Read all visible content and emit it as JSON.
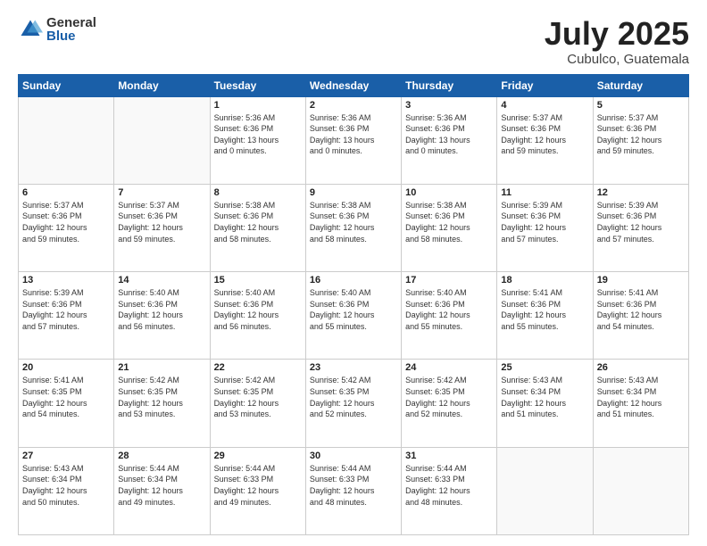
{
  "logo": {
    "general": "General",
    "blue": "Blue"
  },
  "title": "July 2025",
  "location": "Cubulco, Guatemala",
  "days_header": [
    "Sunday",
    "Monday",
    "Tuesday",
    "Wednesday",
    "Thursday",
    "Friday",
    "Saturday"
  ],
  "weeks": [
    [
      {
        "day": "",
        "info": ""
      },
      {
        "day": "",
        "info": ""
      },
      {
        "day": "1",
        "info": "Sunrise: 5:36 AM\nSunset: 6:36 PM\nDaylight: 13 hours\nand 0 minutes."
      },
      {
        "day": "2",
        "info": "Sunrise: 5:36 AM\nSunset: 6:36 PM\nDaylight: 13 hours\nand 0 minutes."
      },
      {
        "day": "3",
        "info": "Sunrise: 5:36 AM\nSunset: 6:36 PM\nDaylight: 13 hours\nand 0 minutes."
      },
      {
        "day": "4",
        "info": "Sunrise: 5:37 AM\nSunset: 6:36 PM\nDaylight: 12 hours\nand 59 minutes."
      },
      {
        "day": "5",
        "info": "Sunrise: 5:37 AM\nSunset: 6:36 PM\nDaylight: 12 hours\nand 59 minutes."
      }
    ],
    [
      {
        "day": "6",
        "info": "Sunrise: 5:37 AM\nSunset: 6:36 PM\nDaylight: 12 hours\nand 59 minutes."
      },
      {
        "day": "7",
        "info": "Sunrise: 5:37 AM\nSunset: 6:36 PM\nDaylight: 12 hours\nand 59 minutes."
      },
      {
        "day": "8",
        "info": "Sunrise: 5:38 AM\nSunset: 6:36 PM\nDaylight: 12 hours\nand 58 minutes."
      },
      {
        "day": "9",
        "info": "Sunrise: 5:38 AM\nSunset: 6:36 PM\nDaylight: 12 hours\nand 58 minutes."
      },
      {
        "day": "10",
        "info": "Sunrise: 5:38 AM\nSunset: 6:36 PM\nDaylight: 12 hours\nand 58 minutes."
      },
      {
        "day": "11",
        "info": "Sunrise: 5:39 AM\nSunset: 6:36 PM\nDaylight: 12 hours\nand 57 minutes."
      },
      {
        "day": "12",
        "info": "Sunrise: 5:39 AM\nSunset: 6:36 PM\nDaylight: 12 hours\nand 57 minutes."
      }
    ],
    [
      {
        "day": "13",
        "info": "Sunrise: 5:39 AM\nSunset: 6:36 PM\nDaylight: 12 hours\nand 57 minutes."
      },
      {
        "day": "14",
        "info": "Sunrise: 5:40 AM\nSunset: 6:36 PM\nDaylight: 12 hours\nand 56 minutes."
      },
      {
        "day": "15",
        "info": "Sunrise: 5:40 AM\nSunset: 6:36 PM\nDaylight: 12 hours\nand 56 minutes."
      },
      {
        "day": "16",
        "info": "Sunrise: 5:40 AM\nSunset: 6:36 PM\nDaylight: 12 hours\nand 55 minutes."
      },
      {
        "day": "17",
        "info": "Sunrise: 5:40 AM\nSunset: 6:36 PM\nDaylight: 12 hours\nand 55 minutes."
      },
      {
        "day": "18",
        "info": "Sunrise: 5:41 AM\nSunset: 6:36 PM\nDaylight: 12 hours\nand 55 minutes."
      },
      {
        "day": "19",
        "info": "Sunrise: 5:41 AM\nSunset: 6:36 PM\nDaylight: 12 hours\nand 54 minutes."
      }
    ],
    [
      {
        "day": "20",
        "info": "Sunrise: 5:41 AM\nSunset: 6:35 PM\nDaylight: 12 hours\nand 54 minutes."
      },
      {
        "day": "21",
        "info": "Sunrise: 5:42 AM\nSunset: 6:35 PM\nDaylight: 12 hours\nand 53 minutes."
      },
      {
        "day": "22",
        "info": "Sunrise: 5:42 AM\nSunset: 6:35 PM\nDaylight: 12 hours\nand 53 minutes."
      },
      {
        "day": "23",
        "info": "Sunrise: 5:42 AM\nSunset: 6:35 PM\nDaylight: 12 hours\nand 52 minutes."
      },
      {
        "day": "24",
        "info": "Sunrise: 5:42 AM\nSunset: 6:35 PM\nDaylight: 12 hours\nand 52 minutes."
      },
      {
        "day": "25",
        "info": "Sunrise: 5:43 AM\nSunset: 6:34 PM\nDaylight: 12 hours\nand 51 minutes."
      },
      {
        "day": "26",
        "info": "Sunrise: 5:43 AM\nSunset: 6:34 PM\nDaylight: 12 hours\nand 51 minutes."
      }
    ],
    [
      {
        "day": "27",
        "info": "Sunrise: 5:43 AM\nSunset: 6:34 PM\nDaylight: 12 hours\nand 50 minutes."
      },
      {
        "day": "28",
        "info": "Sunrise: 5:44 AM\nSunset: 6:34 PM\nDaylight: 12 hours\nand 49 minutes."
      },
      {
        "day": "29",
        "info": "Sunrise: 5:44 AM\nSunset: 6:33 PM\nDaylight: 12 hours\nand 49 minutes."
      },
      {
        "day": "30",
        "info": "Sunrise: 5:44 AM\nSunset: 6:33 PM\nDaylight: 12 hours\nand 48 minutes."
      },
      {
        "day": "31",
        "info": "Sunrise: 5:44 AM\nSunset: 6:33 PM\nDaylight: 12 hours\nand 48 minutes."
      },
      {
        "day": "",
        "info": ""
      },
      {
        "day": "",
        "info": ""
      }
    ]
  ]
}
